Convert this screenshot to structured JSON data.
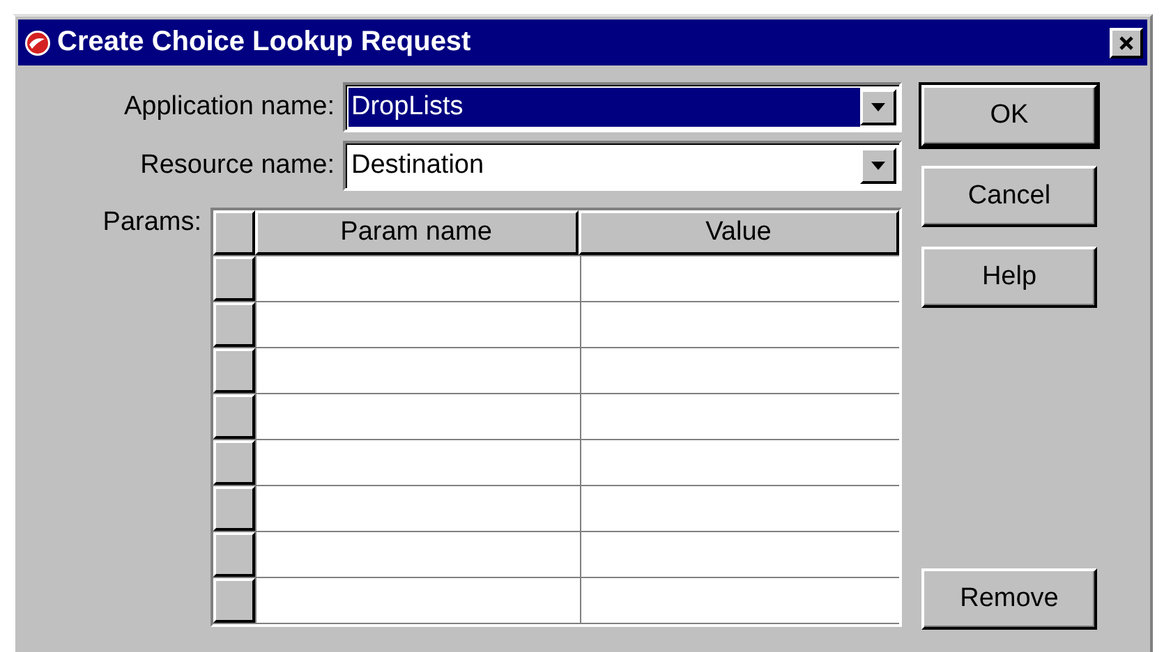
{
  "window": {
    "title": "Create Choice Lookup Request"
  },
  "fields": [
    {
      "label": "Application name:",
      "value": "DropLists",
      "focused": true
    },
    {
      "label": "Resource name:",
      "value": "Destination",
      "focused": false
    }
  ],
  "params": {
    "label": "Params:",
    "columns": [
      "Param name",
      "Value"
    ],
    "rows": [
      {
        "kind": "empty"
      },
      {
        "kind": "empty"
      },
      {
        "kind": "empty"
      },
      {
        "kind": "empty"
      },
      {
        "kind": "empty"
      },
      {
        "kind": "empty"
      },
      {
        "kind": "empty"
      },
      {
        "kind": "empty"
      }
    ]
  },
  "buttons": [
    {
      "label": "OK",
      "default": true,
      "kind": "top"
    },
    {
      "label": "Cancel",
      "default": false,
      "kind": "top"
    },
    {
      "label": "Help",
      "default": false,
      "kind": "top"
    },
    {
      "label": "Remove",
      "default": false,
      "kind": "bottom"
    }
  ]
}
